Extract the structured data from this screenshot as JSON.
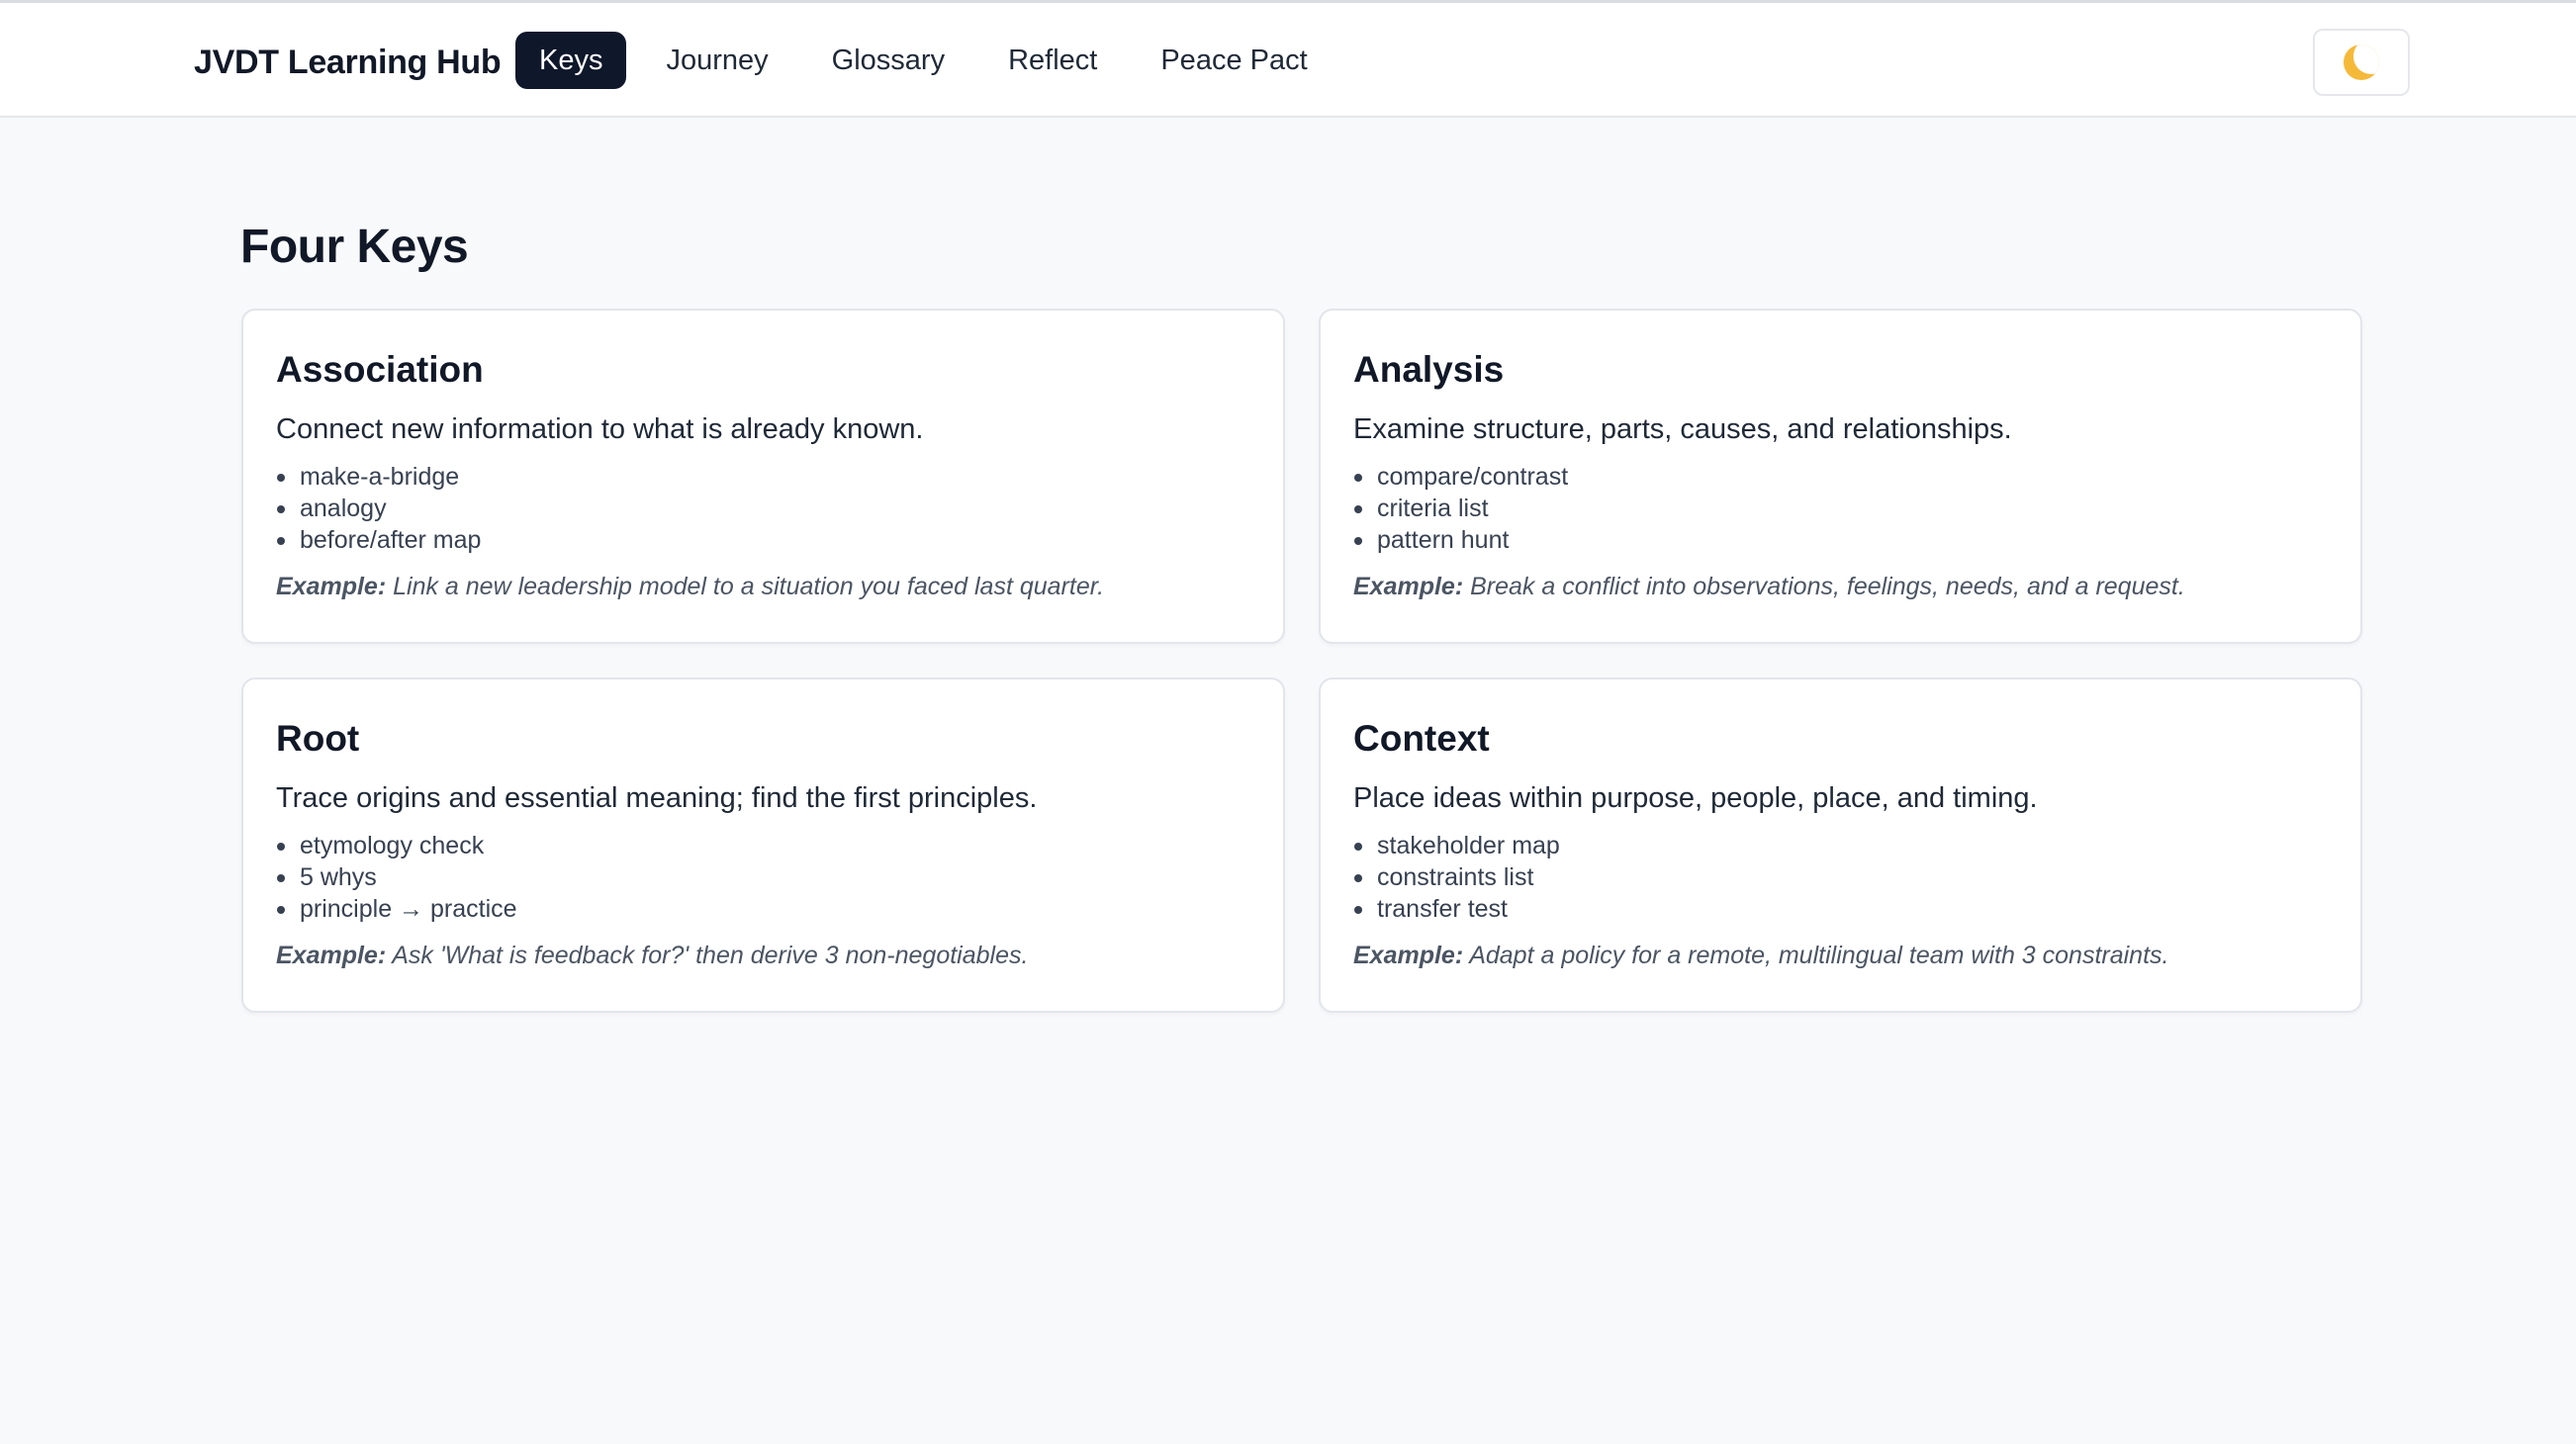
{
  "header": {
    "brand": "JVDT Learning Hub",
    "nav": [
      "Keys",
      "Journey",
      "Glossary",
      "Reflect",
      "Peace Pact"
    ],
    "active_nav": "Keys",
    "theme_icon": "moon-icon"
  },
  "main": {
    "title": "Four Keys",
    "cards": [
      {
        "title": "Association",
        "description": "Connect new information to what is already known.",
        "items": [
          "make-a-bridge",
          "analogy",
          "before/after map"
        ],
        "example_label": "Example:",
        "example_text": "Link a new leadership model to a situation you faced last quarter."
      },
      {
        "title": "Analysis",
        "description": "Examine structure, parts, causes, and relationships.",
        "items": [
          "compare/contrast",
          "criteria list",
          "pattern hunt"
        ],
        "example_label": "Example:",
        "example_text": "Break a conflict into observations, feelings, needs, and a request."
      },
      {
        "title": "Root",
        "description": "Trace origins and essential meaning; find the first principles.",
        "items": [
          "etymology check",
          "5 whys",
          "principle → practice"
        ],
        "example_label": "Example:",
        "example_text": "Ask 'What is feedback for?' then derive 3 non-negotiables."
      },
      {
        "title": "Context",
        "description": "Place ideas within purpose, people, place, and timing.",
        "items": [
          "stakeholder map",
          "constraints list",
          "transfer test"
        ],
        "example_label": "Example:",
        "example_text": "Adapt a policy for a remote, multilingual team with 3 constraints."
      }
    ]
  }
}
